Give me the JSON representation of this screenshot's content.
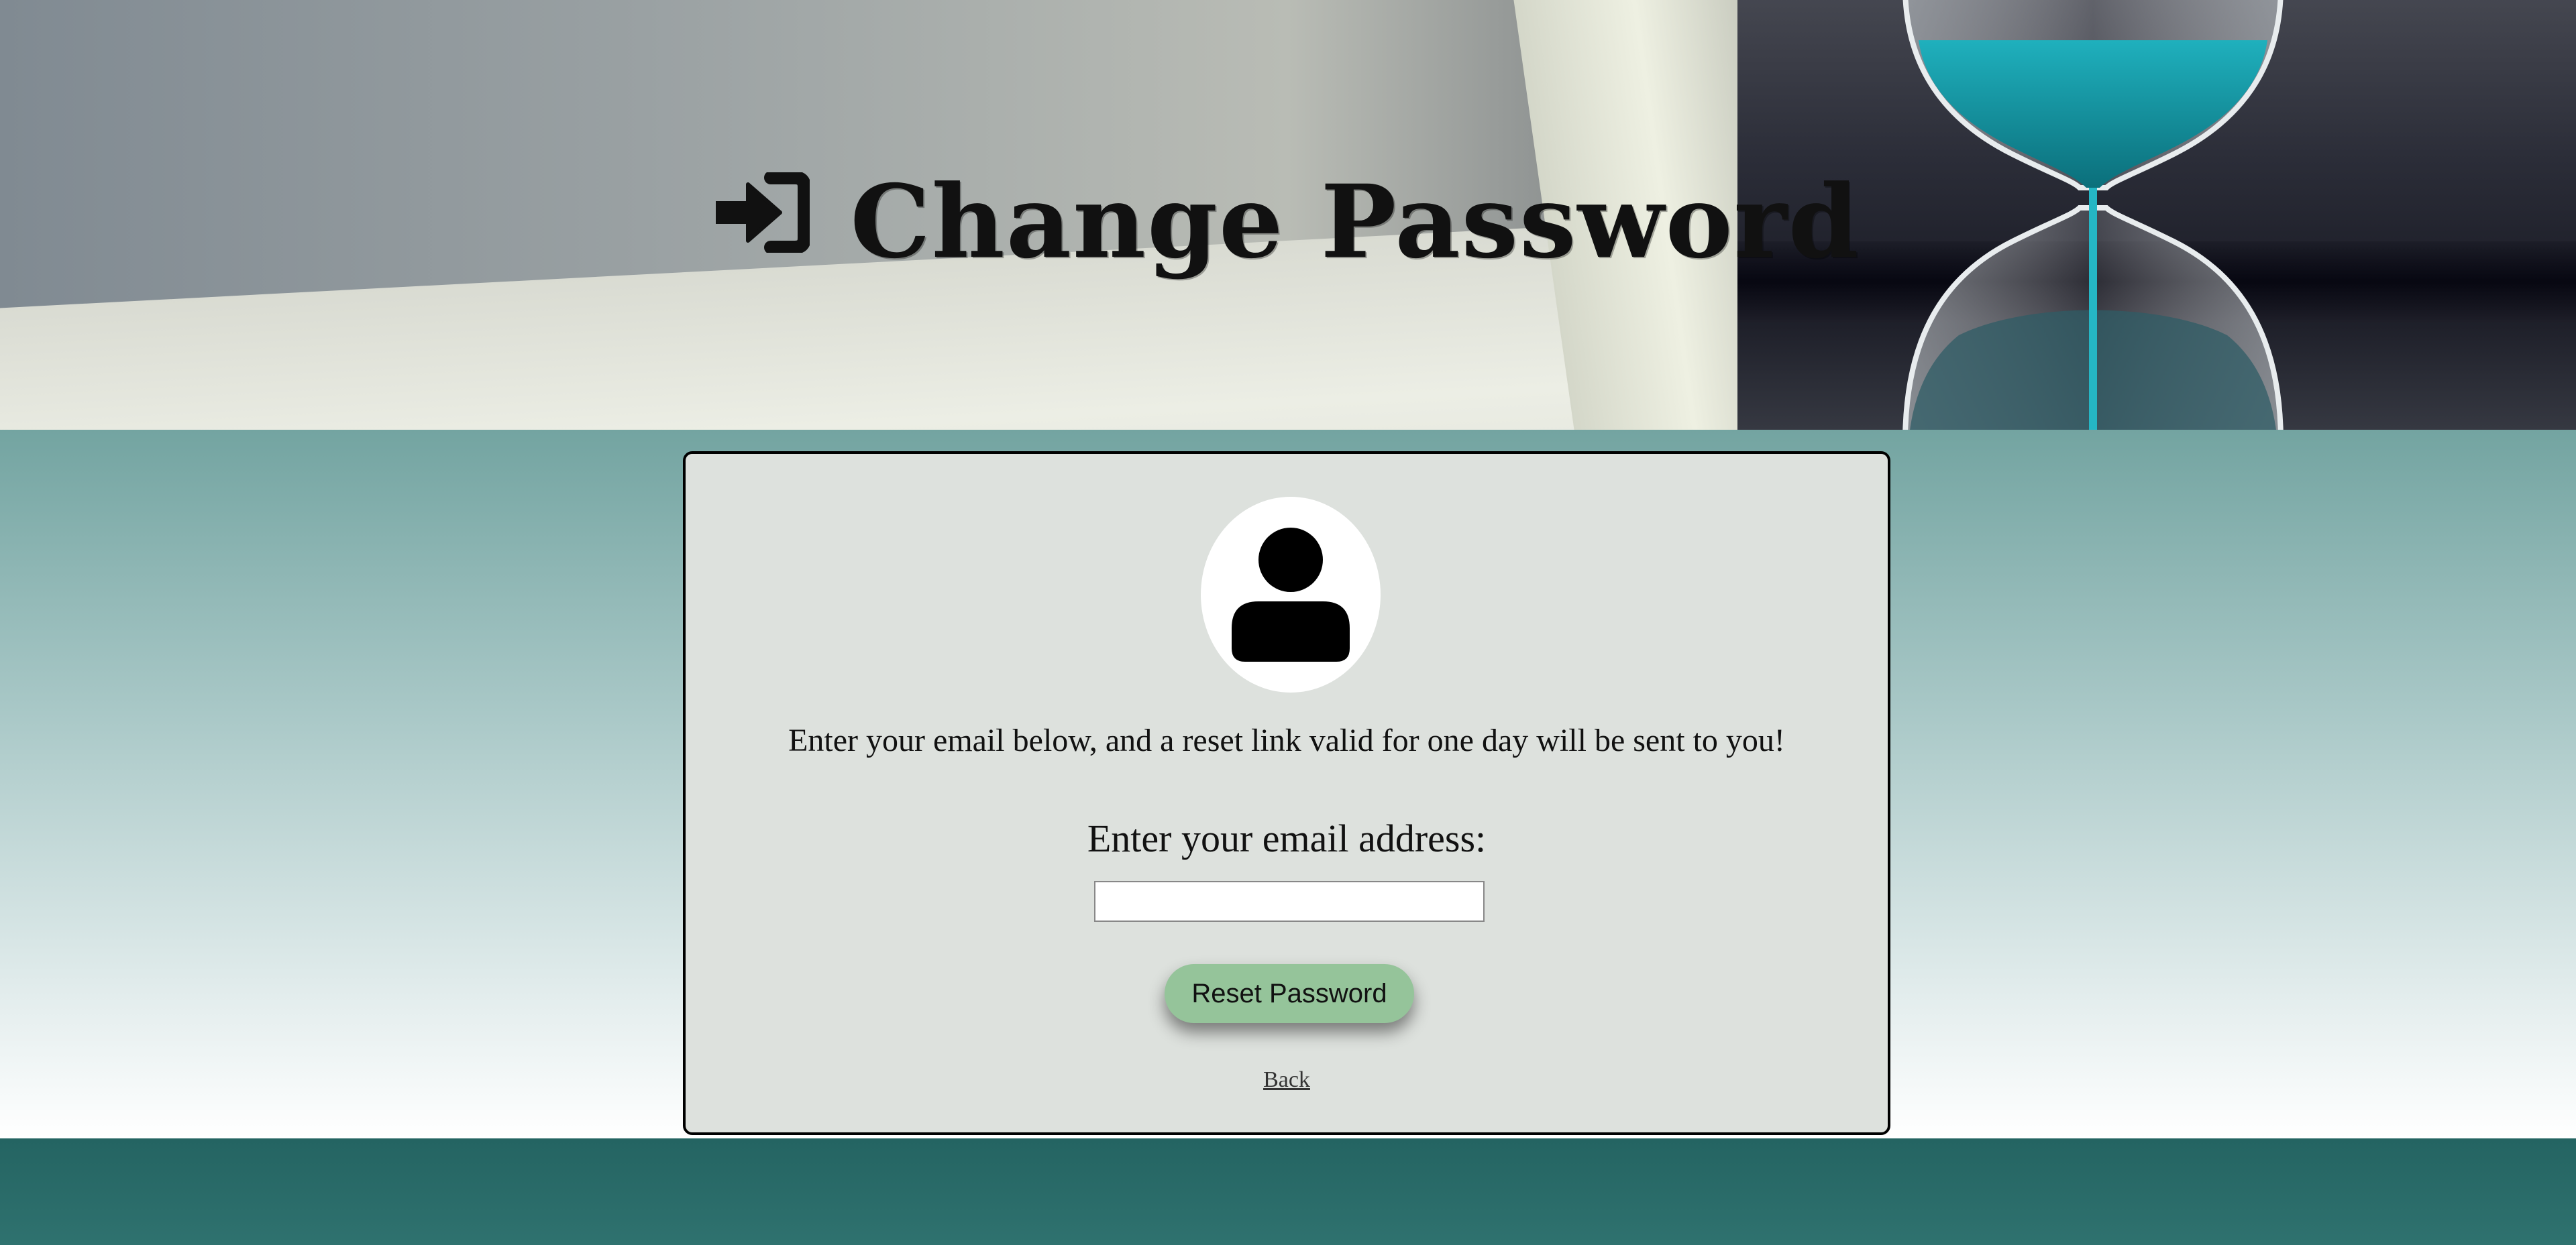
{
  "header": {
    "title": "Change Password",
    "title_icon": "sign-in-icon"
  },
  "card": {
    "avatar_icon": "user-icon",
    "intro_text": "Enter your email below, and a reset link valid for one day will be sent to you!",
    "email_label": "Enter your email address:",
    "email_value": "",
    "email_placeholder": "",
    "submit_label": "Reset Password",
    "back_label": "Back"
  },
  "colors": {
    "button": "#95c49a",
    "card_bg": "#dde1dd",
    "footer": "#246462",
    "gradient_top": "#73a4a1"
  }
}
